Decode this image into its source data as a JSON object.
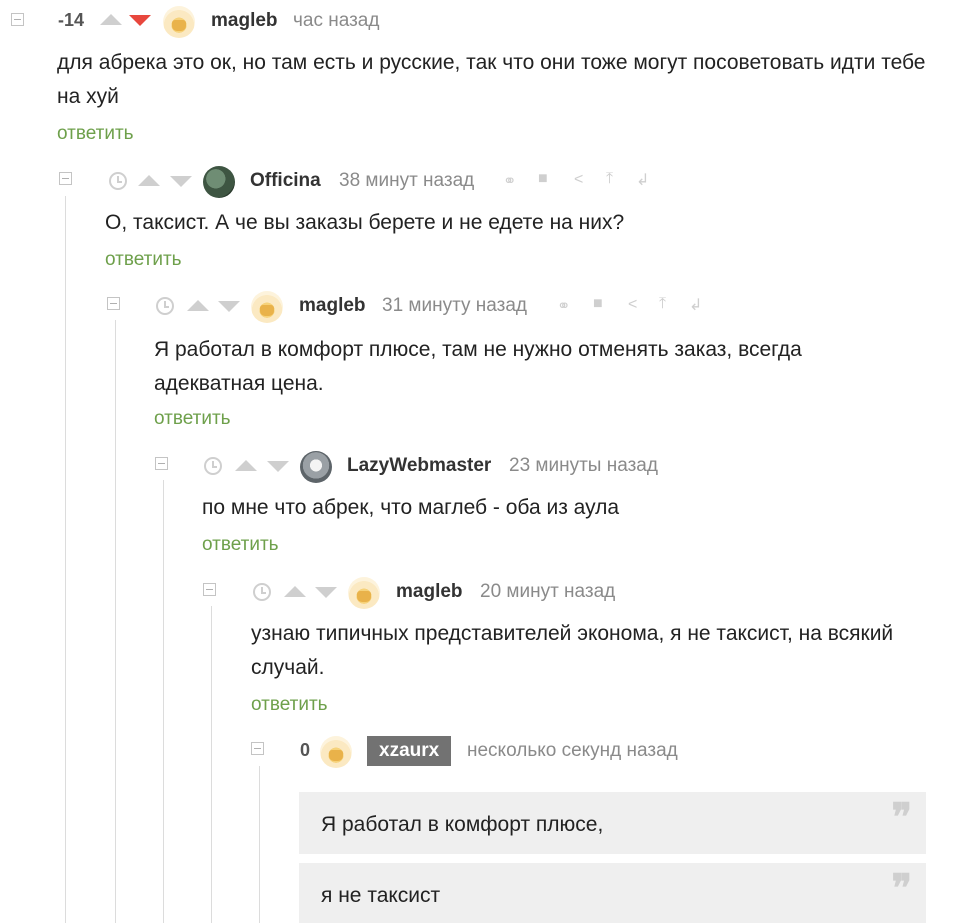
{
  "comments": [
    {
      "rating": "-14",
      "user": "magleb",
      "time": "час назад",
      "text": "для абрека это ок, но там есть и русские, так что они тоже могут посоветовать идти тебе на хуй",
      "reply": "ответить"
    },
    {
      "user": "Officina",
      "time": "38 минут назад",
      "text": "О, таксист. А че вы заказы берете и не едете на них?",
      "reply": "ответить"
    },
    {
      "user": "magleb",
      "time": "31 минуту назад",
      "text": "Я работал в комфорт плюсе, там не нужно отменять заказ, всегда адекватная цена.",
      "reply": "ответить"
    },
    {
      "user": "LazyWebmaster",
      "time": "23 минуты назад",
      "text": "по мне что абрек, что маглеб - оба из аула",
      "reply": "ответить"
    },
    {
      "user": "magleb",
      "time": "20 минут назад",
      "text": "узнаю типичных представителей эконома, я не таксист, на всякий случай.",
      "reply": "ответить"
    },
    {
      "rating": "0",
      "user": "xzaurx",
      "time": "несколько секунд назад",
      "quotes": [
        "Я работал в комфорт плюсе,",
        "я не таксист"
      ]
    }
  ],
  "icons": {
    "quote": "❞",
    "collapse": "collapse-icon",
    "clock": "clock-icon"
  },
  "colors": {
    "reply_link": "#6ea04b",
    "downvote_active": "#e8473d",
    "own_user_badge": "#727272"
  }
}
